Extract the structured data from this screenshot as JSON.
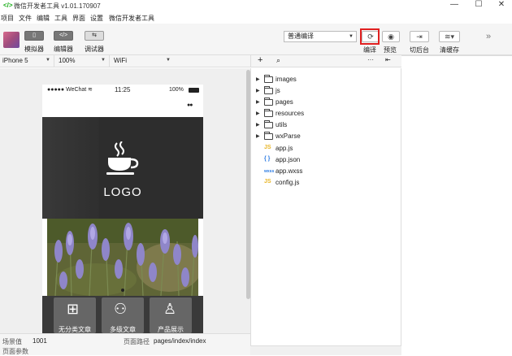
{
  "window": {
    "app_icon": "wechat-devtools-logo",
    "title": "微信开发者工具 v1.01.170907",
    "controls": [
      "minimize-icon",
      "maximize-icon",
      "close-icon"
    ]
  },
  "menubar": {
    "items": [
      "项目",
      "文件",
      "编辑",
      "工具",
      "界面",
      "设置",
      "微信开发者工具"
    ]
  },
  "toolbar": {
    "simulator_label": "模拟器",
    "editor_label": "编辑器",
    "debugger_label": "调试器",
    "compile_mode": "普通编译",
    "compile_label": "编译",
    "preview_label": "预览",
    "background_label": "切后台",
    "clear_cache_label": "清缓存",
    "accent_highlight": "#e02020"
  },
  "devbar": {
    "device": "iPhone 5",
    "zoom": "100%",
    "network": "WiFi"
  },
  "phone": {
    "carrier": "●●●●● WeChat",
    "time": "11:25",
    "battery": "100%",
    "menu_dots": "●●",
    "logo_text": "LOGO",
    "tiles": [
      {
        "label": "无分类文章",
        "icon": "grid-search-icon"
      },
      {
        "label": "多级文章",
        "icon": "users-icon"
      },
      {
        "label": "产品展示",
        "icon": "user-icon"
      }
    ]
  },
  "footer": {
    "scene_label": "场景值",
    "scene_value": "1001",
    "path_label": "页面路径",
    "path_value": "pages/index/index",
    "params_label": "页面参数"
  },
  "filetree": {
    "folders": [
      "images",
      "js",
      "pages",
      "resources",
      "utils",
      "wxParse"
    ],
    "files": [
      {
        "name": "app.js",
        "badge": "JS",
        "color": "#e8b526"
      },
      {
        "name": "app.json",
        "badge": "{ }",
        "color": "#2a7ae2"
      },
      {
        "name": "app.wxss",
        "badge": "wxss",
        "color": "#2a7ae2"
      },
      {
        "name": "config.js",
        "badge": "JS",
        "color": "#e8b526"
      }
    ]
  }
}
